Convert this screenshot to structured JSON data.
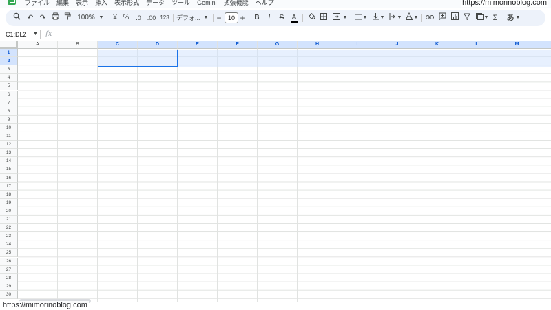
{
  "menu": {
    "items": [
      "ファイル",
      "編集",
      "表示",
      "挿入",
      "表示形式",
      "データ",
      "ツール",
      "Gemini",
      "拡張機能",
      "ヘルプ"
    ]
  },
  "watermark": {
    "top": "https://mimorinoblog.com",
    "bottom": "https://mimorinoblog.com"
  },
  "toolbar": {
    "zoom": "100%",
    "currency": "¥",
    "percent": "%",
    "decrease_decimal": ".0",
    "increase_decimal": ".00",
    "number_format": "123",
    "font": "デフォ...",
    "minus": "−",
    "font_size": "10",
    "plus": "+",
    "bold": "B",
    "italic": "I",
    "strikethrough": "S",
    "text_color": "A",
    "sum": "Σ",
    "input_tools": "あ"
  },
  "formula_bar": {
    "name_box": "C1:DL2",
    "fx": "fx"
  },
  "sheet": {
    "columns": [
      "A",
      "B",
      "C",
      "D",
      "E",
      "F",
      "G",
      "H",
      "I",
      "J",
      "K",
      "L",
      "M"
    ],
    "selected_columns": [
      "C",
      "D",
      "E",
      "F",
      "G",
      "H",
      "I",
      "J",
      "K",
      "L",
      "M"
    ],
    "rows": [
      "1",
      "2",
      "3",
      "4",
      "5",
      "6",
      "7",
      "8",
      "9",
      "10",
      "11",
      "12",
      "13",
      "14",
      "15",
      "16",
      "17",
      "18",
      "19",
      "20",
      "21",
      "22",
      "23",
      "24",
      "25",
      "26",
      "27",
      "28",
      "29",
      "30"
    ],
    "selected_rows": [
      "1",
      "2"
    ]
  },
  "colors": {
    "accent": "#1a73e8",
    "selection": "#d3e3fd",
    "app_green": "#34a853",
    "toolbar_bg": "#edf2fa"
  }
}
